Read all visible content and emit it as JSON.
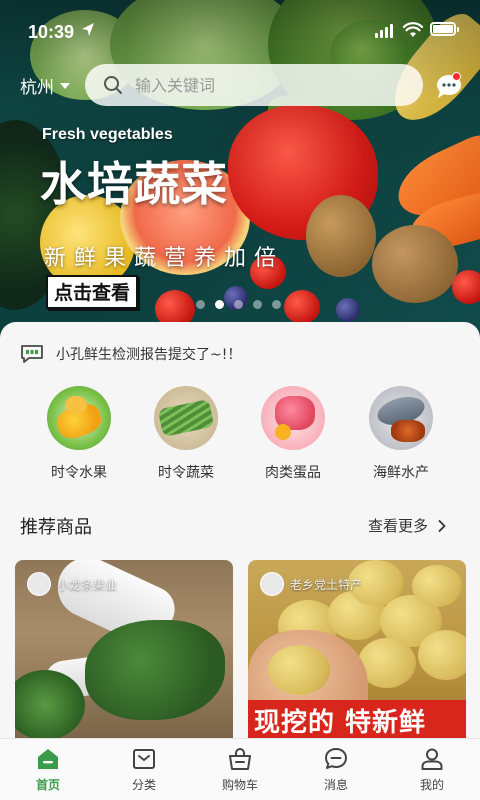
{
  "status_bar": {
    "time": "10:39"
  },
  "header": {
    "city": "杭州",
    "search_placeholder": "输入关键词"
  },
  "banner": {
    "english_tag": "Fresh vegetables",
    "title": "水培蔬菜",
    "subtitle": "新鲜果蔬营养加倍",
    "cta": "点击查看",
    "slide_count": 5,
    "active_slide": 2
  },
  "notice": {
    "text": "小孔鲜生检测报告提交了~!！"
  },
  "categories": [
    {
      "label": "时令水果",
      "icon": "fruit-image"
    },
    {
      "label": "时令蔬菜",
      "icon": "vegetable-image"
    },
    {
      "label": "肉类蛋品",
      "icon": "meat-egg-image"
    },
    {
      "label": "海鲜水产",
      "icon": "seafood-image"
    }
  ],
  "recommend": {
    "title": "推荐商品",
    "more": "查看更多"
  },
  "products": [
    {
      "shop": "小龙条果业"
    },
    {
      "shop": "老乡党土特产",
      "promo": "现挖的 特新鲜"
    }
  ],
  "tabbar": [
    {
      "label": "首页",
      "icon": "home-icon",
      "active": true
    },
    {
      "label": "分类",
      "icon": "category-icon",
      "active": false
    },
    {
      "label": "购物车",
      "icon": "cart-icon",
      "active": false
    },
    {
      "label": "消息",
      "icon": "message-icon",
      "active": false
    },
    {
      "label": "我的",
      "icon": "profile-icon",
      "active": false
    }
  ],
  "colors": {
    "accent_green": "#3a9c4a",
    "badge_red": "#ff2b2b",
    "promo_red": "#d9261c"
  }
}
